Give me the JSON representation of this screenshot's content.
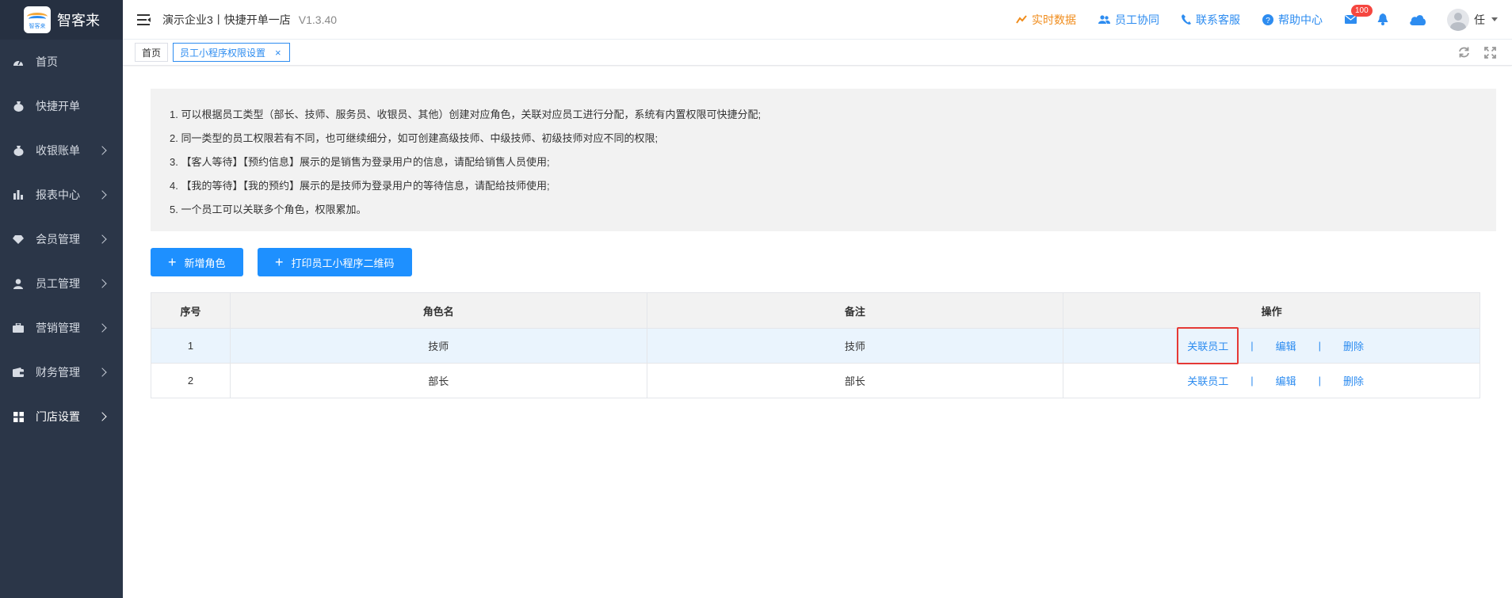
{
  "brand": {
    "name": "智客来",
    "logo_caption": "智客来"
  },
  "sidebar": {
    "items": [
      {
        "label": "首页",
        "icon": "dashboard-icon",
        "has_arrow": false
      },
      {
        "label": "快捷开单",
        "icon": "money-bag-icon",
        "has_arrow": false
      },
      {
        "label": "收银账单",
        "icon": "money-bag-icon",
        "has_arrow": true
      },
      {
        "label": "报表中心",
        "icon": "bar-chart-icon",
        "has_arrow": true
      },
      {
        "label": "会员管理",
        "icon": "diamond-icon",
        "has_arrow": true
      },
      {
        "label": "员工管理",
        "icon": "user-icon",
        "has_arrow": true
      },
      {
        "label": "营销管理",
        "icon": "briefcase-icon",
        "has_arrow": true
      },
      {
        "label": "财务管理",
        "icon": "wallet-icon",
        "has_arrow": true
      },
      {
        "label": "门店设置",
        "icon": "grid-icon",
        "has_arrow": true,
        "active": true
      }
    ]
  },
  "header": {
    "company": "演示企业3丨快捷开单一店",
    "version": "V1.3.40",
    "links": {
      "realtime": "实时数据",
      "staff_collab": "员工协同",
      "contact_service": "联系客服",
      "help_center": "帮助中心"
    },
    "mail_badge": "100",
    "user_name": "任"
  },
  "tabs": {
    "home": "首页",
    "current": "员工小程序权限设置",
    "close": "×"
  },
  "notice": [
    "1. 可以根据员工类型（部长、技师、服务员、收银员、其他）创建对应角色，关联对应员工进行分配，系统有内置权限可快捷分配;",
    "2. 同一类型的员工权限若有不同，也可继续细分，如可创建高级技师、中级技师、初级技师对应不同的权限;",
    "3. 【客人等待】【预约信息】展示的是销售为登录用户的信息，请配给销售人员使用;",
    "4. 【我的等待】【我的预约】展示的是技师为登录用户的等待信息，请配给技师使用;",
    "5. 一个员工可以关联多个角色，权限累加。"
  ],
  "buttons": {
    "add_role": "新增角色",
    "print_qr": "打印员工小程序二维码"
  },
  "table": {
    "headers": [
      "序号",
      "角色名",
      "备注",
      "操作"
    ],
    "rows": [
      {
        "index": "1",
        "role": "技师",
        "remark": "技师"
      },
      {
        "index": "2",
        "role": "部长",
        "remark": "部长"
      }
    ],
    "ops": {
      "link": "关联员工",
      "edit": "编辑",
      "delete": "删除",
      "separator": "|"
    }
  },
  "colors": {
    "sidebar_bg": "#2b3648",
    "accent": "#2d8cf0",
    "button": "#1e90ff",
    "highlight_frame": "#e53935",
    "realtime": "#f08c1c"
  }
}
